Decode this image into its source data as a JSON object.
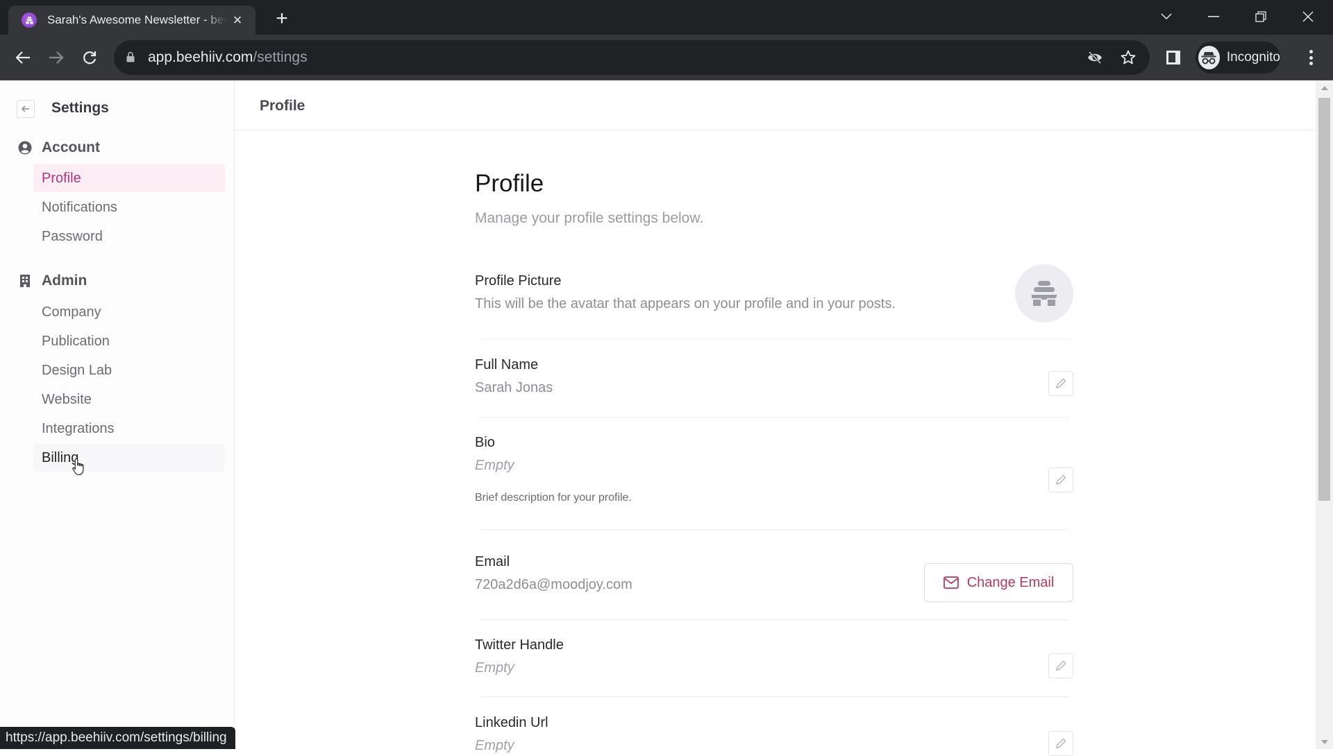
{
  "browser": {
    "tab_title": "Sarah's Awesome Newsletter - beehiiv",
    "url_host": "app.beehiiv.com",
    "url_path": "/settings",
    "profile_label": "Incognito",
    "status_url": "https://app.beehiiv.com/settings/billing"
  },
  "icons": {
    "tab_close": "×",
    "new_tab": "+"
  },
  "sidebar": {
    "title": "Settings",
    "sections": [
      {
        "label": "Account",
        "icon": "user-circle-icon",
        "items": [
          {
            "label": "Profile",
            "state": "active"
          },
          {
            "label": "Notifications",
            "state": "normal"
          },
          {
            "label": "Password",
            "state": "normal"
          }
        ]
      },
      {
        "label": "Admin",
        "icon": "building-icon",
        "items": [
          {
            "label": "Company",
            "state": "normal"
          },
          {
            "label": "Publication",
            "state": "normal"
          },
          {
            "label": "Design Lab",
            "state": "normal"
          },
          {
            "label": "Website",
            "state": "normal"
          },
          {
            "label": "Integrations",
            "state": "normal"
          },
          {
            "label": "Billing",
            "state": "hover"
          }
        ]
      }
    ]
  },
  "header": {
    "title": "Profile"
  },
  "profile": {
    "title": "Profile",
    "subtitle": "Manage your profile settings below.",
    "picture": {
      "label": "Profile Picture",
      "description": "This will be the avatar that appears on your profile and in your posts."
    },
    "fields": {
      "full_name": {
        "label": "Full Name",
        "value": "Sarah Jonas"
      },
      "bio": {
        "label": "Bio",
        "value": "Empty",
        "help": "Brief description for your profile."
      },
      "email": {
        "label": "Email",
        "value": "720a2d6a@moodjoy.com",
        "action": "Change Email"
      },
      "twitter": {
        "label": "Twitter Handle",
        "value": "Empty"
      },
      "linkedin": {
        "label": "Linkedin Url",
        "value": "Empty"
      }
    }
  },
  "colors": {
    "accent": "#b3347a",
    "accent_bg": "#fdeef6",
    "action": "#b8385f"
  }
}
